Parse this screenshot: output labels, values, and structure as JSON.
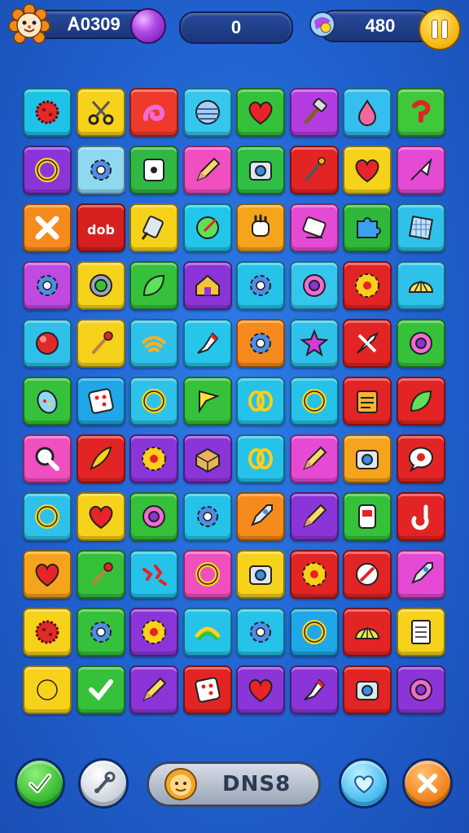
{
  "hud": {
    "score": "Ꭺ0309",
    "moves": "0",
    "coins": "480",
    "icons": {
      "avatar": "lion-face-icon",
      "gem": "purple-gem-icon",
      "coin": "globe-coin-icon",
      "pause": "pause-icon"
    }
  },
  "board": {
    "rows": 11,
    "cols": 8,
    "tiles": [
      [
        {
          "c": "#1fc3e8",
          "i": "red-virus-icon"
        },
        {
          "c": "#f6d21a",
          "i": "scissors-icon"
        },
        {
          "c": "#ee3a2a",
          "i": "pink-swirl-icon"
        },
        {
          "c": "#35c7ee",
          "i": "planet-ball-icon"
        },
        {
          "c": "#35c23a",
          "i": "heart-icon"
        },
        {
          "c": "#b33de0",
          "i": "hammer-icon"
        },
        {
          "c": "#34bff0",
          "i": "drop-icon"
        },
        {
          "c": "#3ec83a",
          "i": "red-hook-icon"
        }
      ],
      [
        {
          "c": "#8b35d8",
          "i": "ring-icon"
        },
        {
          "c": "#8ed8f0",
          "i": "gear-icon"
        },
        {
          "c": "#30b843",
          "i": "device-icon"
        },
        {
          "c": "#f04fbf",
          "i": "pencil-icon"
        },
        {
          "c": "#2fbf45",
          "i": "camera-icon"
        },
        {
          "c": "#e32424",
          "i": "brush-icon"
        },
        {
          "c": "#f6d21a",
          "i": "heart-icon"
        },
        {
          "c": "#e54ad4",
          "i": "arrow-icon"
        }
      ],
      [
        {
          "c": "#f68a1c",
          "i": "cross-icon"
        },
        {
          "c": "#d61f1f",
          "i": "text-tag-icon"
        },
        {
          "c": "#f6d21a",
          "i": "grater-icon"
        },
        {
          "c": "#22c6ea",
          "i": "paint-pot-icon"
        },
        {
          "c": "#f6a41c",
          "i": "hand-icon"
        },
        {
          "c": "#e54ad4",
          "i": "stamp-icon"
        },
        {
          "c": "#2fb83a",
          "i": "puzzle-icon"
        },
        {
          "c": "#2ec2ea",
          "i": "grid-box-icon"
        }
      ],
      [
        {
          "c": "#c04ae0",
          "i": "gear-icon"
        },
        {
          "c": "#f6d21a",
          "i": "lens-icon"
        },
        {
          "c": "#36c13a",
          "i": "leaf-icon"
        },
        {
          "c": "#8b35d8",
          "i": "house-icon"
        },
        {
          "c": "#25c2e9",
          "i": "gear-icon"
        },
        {
          "c": "#35c6ee",
          "i": "donut-icon"
        },
        {
          "c": "#e32424",
          "i": "sun-gear-icon"
        },
        {
          "c": "#2ec2ea",
          "i": "shell-icon"
        }
      ],
      [
        {
          "c": "#2fc0ea",
          "i": "ball-icon"
        },
        {
          "c": "#f6d21a",
          "i": "match-icon"
        },
        {
          "c": "#2ec2ea",
          "i": "wifi-icon"
        },
        {
          "c": "#25c6ea",
          "i": "marker-icon"
        },
        {
          "c": "#f68a1c",
          "i": "gear-icon"
        },
        {
          "c": "#2ec2ea",
          "i": "star-icon"
        },
        {
          "c": "#e32424",
          "i": "knife-icon"
        },
        {
          "c": "#35c23a",
          "i": "donut-icon"
        }
      ],
      [
        {
          "c": "#35c23a",
          "i": "egg-icon"
        },
        {
          "c": "#1fa7e8",
          "i": "dice-icon"
        },
        {
          "c": "#2ec2ea",
          "i": "ring-icon"
        },
        {
          "c": "#36c13a",
          "i": "flag-icon"
        },
        {
          "c": "#25c2e9",
          "i": "chain-icon"
        },
        {
          "c": "#25c2e9",
          "i": "ring-icon"
        },
        {
          "c": "#e32424",
          "i": "calendar-icon"
        },
        {
          "c": "#e32424",
          "i": "leaf-icon"
        }
      ],
      [
        {
          "c": "#f04fbf",
          "i": "magnifier-icon"
        },
        {
          "c": "#e32424",
          "i": "feather-icon"
        },
        {
          "c": "#8b35d8",
          "i": "sun-gear-icon"
        },
        {
          "c": "#8b35d8",
          "i": "box-icon"
        },
        {
          "c": "#25c2e9",
          "i": "chain-icon"
        },
        {
          "c": "#e54ad4",
          "i": "pencil-icon"
        },
        {
          "c": "#f6a41c",
          "i": "camera-icon"
        },
        {
          "c": "#e32424",
          "i": "speech-icon"
        }
      ],
      [
        {
          "c": "#2ec2ea",
          "i": "ring-icon"
        },
        {
          "c": "#f6d21a",
          "i": "heart-icon"
        },
        {
          "c": "#36c13a",
          "i": "donut-icon"
        },
        {
          "c": "#25c2e9",
          "i": "gear-icon"
        },
        {
          "c": "#f68a1c",
          "i": "rocket-icon"
        },
        {
          "c": "#8b35d8",
          "i": "pencil-icon"
        },
        {
          "c": "#36c13a",
          "i": "phone-icon"
        },
        {
          "c": "#e32424",
          "i": "hook-icon"
        }
      ],
      [
        {
          "c": "#f6a41c",
          "i": "heart-icon"
        },
        {
          "c": "#36c13a",
          "i": "match-icon"
        },
        {
          "c": "#25c2e9",
          "i": "sparks-icon"
        },
        {
          "c": "#f04fbf",
          "i": "ring-icon"
        },
        {
          "c": "#f6d21a",
          "i": "camera-icon"
        },
        {
          "c": "#e32424",
          "i": "sun-gear-icon"
        },
        {
          "c": "#e32424",
          "i": "compass-icon"
        },
        {
          "c": "#e54ad4",
          "i": "rocket-icon"
        }
      ],
      [
        {
          "c": "#f6d21a",
          "i": "red-virus-icon"
        },
        {
          "c": "#36c13a",
          "i": "gear-icon"
        },
        {
          "c": "#8b35d8",
          "i": "sun-gear-icon"
        },
        {
          "c": "#25c2e9",
          "i": "wave-icon"
        },
        {
          "c": "#25c2e9",
          "i": "gear-icon"
        },
        {
          "c": "#1fa7e8",
          "i": "ring-icon"
        },
        {
          "c": "#e32424",
          "i": "shell-icon"
        },
        {
          "c": "#f6d21a",
          "i": "notepad-icon"
        }
      ],
      [
        {
          "c": "#f6d21a",
          "i": "ring-icon"
        },
        {
          "c": "#36c13a",
          "i": "check-icon"
        },
        {
          "c": "#8b35d8",
          "i": "pencil-icon"
        },
        {
          "c": "#e32424",
          "i": "dice-icon"
        },
        {
          "c": "#8b35d8",
          "i": "heart-icon"
        },
        {
          "c": "#8b35d8",
          "i": "marker-icon"
        },
        {
          "c": "#e32424",
          "i": "camera-icon"
        },
        {
          "c": "#8b35d8",
          "i": "donut-icon"
        }
      ]
    ]
  },
  "bottom": {
    "player_name": "DNS8",
    "icons": {
      "confirm": "check-icon",
      "tool": "wrench-icon",
      "face": "lion-face-icon",
      "hint": "heart-bubble-icon",
      "close": "close-icon"
    }
  }
}
